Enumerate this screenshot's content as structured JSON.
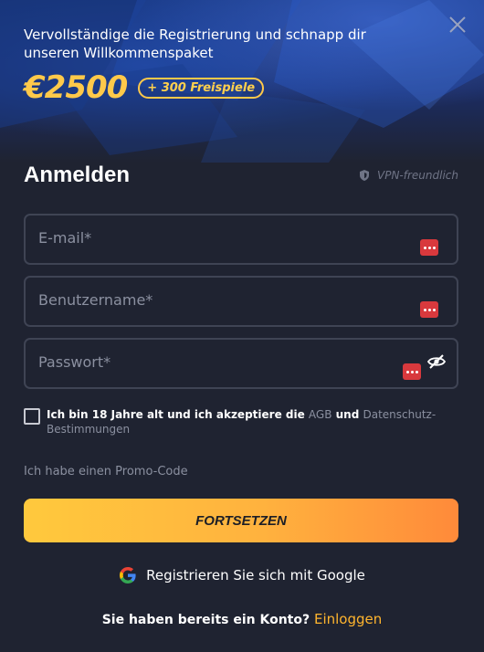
{
  "banner": {
    "headline": "Vervollständige die Registrierung und schnapp dir unseren Willkommenspaket",
    "bonus_amount": "€2500",
    "bonus_badge": "+ 300 Freispiele"
  },
  "form": {
    "title": "Anmelden",
    "vpn_label": "VPN-freundlich",
    "email_placeholder": "E-mail*",
    "username_placeholder": "Benutzername*",
    "password_placeholder": "Passwort*",
    "terms_prefix": "Ich bin 18 Jahre alt und ich akzeptiere die ",
    "terms_agb": "AGB",
    "terms_and": " und ",
    "terms_privacy": "Datenschutz-Bestimmungen",
    "promo_code": "Ich habe einen Promo-Code",
    "submit_label": "FORTSETZEN",
    "google_label": "Registrieren Sie sich mit Google",
    "login_prompt": "Sie haben bereits ein Konto? ",
    "login_link": "Einloggen"
  },
  "icons": {
    "close": "close-icon",
    "vpn": "shield-icon",
    "password_manager": "password-manager-icon",
    "eye": "eye-slash-icon",
    "google": "google-icon"
  },
  "colors": {
    "background": "#1f2331",
    "accent": "#ffc94a",
    "field_border": "#3f4454",
    "muted_text": "#8b90a0",
    "login_link": "#ffb52e"
  }
}
